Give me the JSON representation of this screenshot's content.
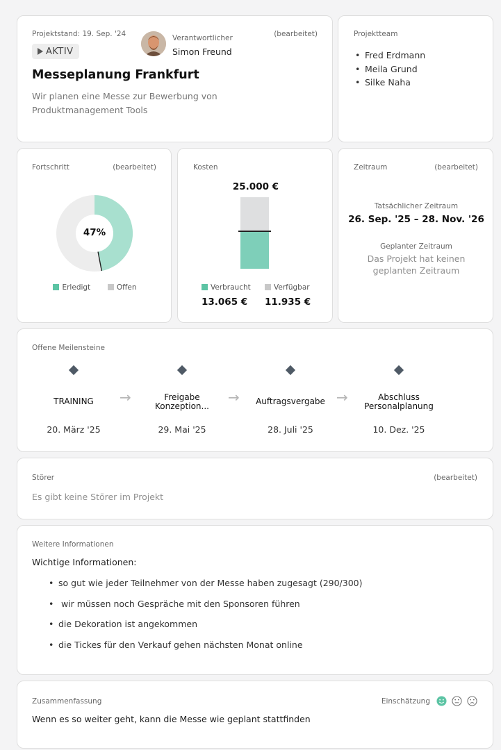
{
  "project": {
    "date_label": "Projektstand: 19. Sep. '24",
    "status": "AKTIV",
    "responsible_label": "Verantwortlicher",
    "responsible_name": "Simon Freund",
    "edited": "(bearbeitet)",
    "title": "Messeplanung Frankfurt",
    "description": "Wir planen eine Messe zur Bewerbung von Produktmanagement Tools"
  },
  "team": {
    "label": "Projektteam",
    "members": [
      "Fred Erdmann",
      "Meila Grund",
      "Silke Naha"
    ]
  },
  "progress": {
    "label": "Fortschritt",
    "edited": "(bearbeitet)",
    "percent_text": "47%",
    "fraction": 0.47,
    "legend_done": "Erledigt",
    "legend_open": "Offen",
    "color_done": "#a8e0cf",
    "color_open": "#ededed"
  },
  "costs": {
    "label": "Kosten",
    "total": "25.000 €",
    "used_fraction": 0.5226,
    "legend_used": "Verbraucht",
    "legend_available": "Verfügbar",
    "used_value": "13.065 €",
    "available_value": "11.935 €",
    "color_used": "#7ecfb9",
    "color_available": "#dedfe0"
  },
  "period": {
    "label": "Zeitraum",
    "edited": "(bearbeitet)",
    "actual_label": "Tatsächlicher Zeitraum",
    "actual_value": "26. Sep. '25 – 28. Nov. '26",
    "planned_label": "Geplanter Zeitraum",
    "planned_value": "Das Projekt hat keinen geplanten Zeitraum"
  },
  "milestones": {
    "label": "Offene Meilensteine",
    "items": [
      {
        "title": "TRAINING",
        "date": "20. März '25"
      },
      {
        "title": "Freigabe Konzeption...",
        "date": "29. Mai '25"
      },
      {
        "title": "Auftragsvergabe",
        "date": "28. Juli '25"
      },
      {
        "title": "Abschluss Personalplanung",
        "date": "10. Dez. '25"
      }
    ]
  },
  "disruptions": {
    "label": "Störer",
    "edited": "(bearbeitet)",
    "text": "Es gibt keine Störer im Projekt"
  },
  "info": {
    "label": "Weitere Informationen",
    "heading": "Wichtige Informationen:",
    "items": [
      "so gut wie jeder Teilnehmer von der Messe haben zugesagt (290/300)",
      " wir müssen noch Gespräche mit den Sponsoren führen",
      "die Dekoration ist angekommen",
      "die Tickes für den Verkauf gehen nächsten Monat online"
    ]
  },
  "summary": {
    "label": "Zusammenfassung",
    "rating_label": "Einschätzung",
    "text": "Wenn es so weiter geht, kann die Messe wie geplant stattfinden",
    "icons": [
      "smile-icon",
      "neutral-face-icon",
      "sad-face-icon"
    ],
    "active_color": "#5cc4a4"
  }
}
